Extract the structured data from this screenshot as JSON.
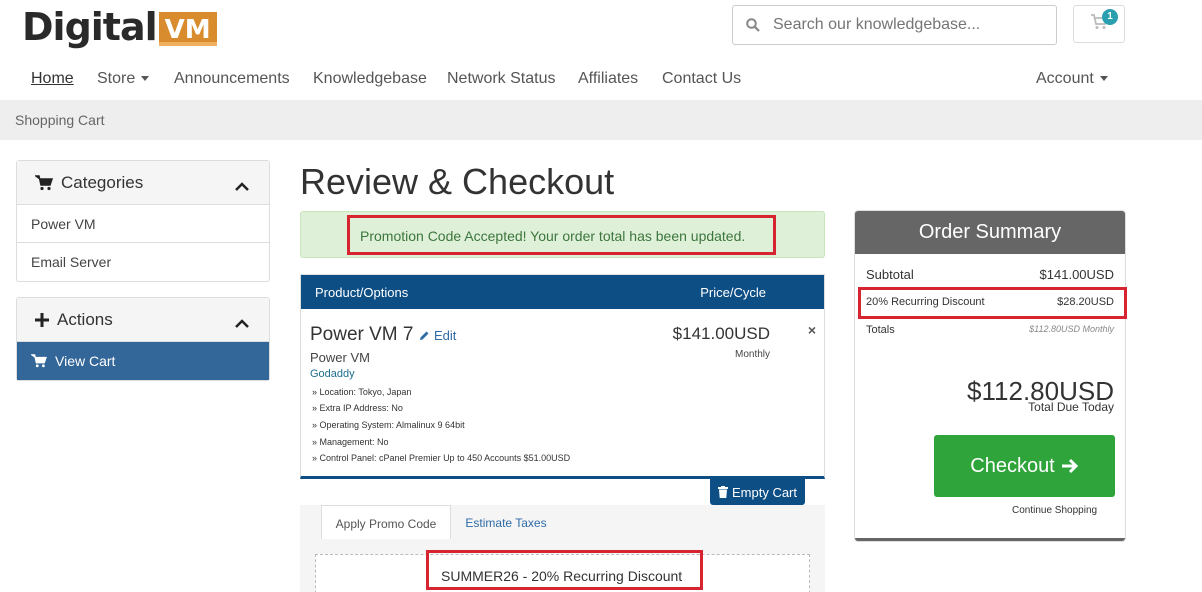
{
  "brand": {
    "name_part1": "Digital",
    "name_part2": "VM"
  },
  "search": {
    "placeholder": "Search our knowledgebase..."
  },
  "cart": {
    "count": "1"
  },
  "nav": {
    "home": "Home",
    "store": "Store",
    "announcements": "Announcements",
    "knowledgebase": "Knowledgebase",
    "network_status": "Network Status",
    "affiliates": "Affiliates",
    "contact_us": "Contact Us",
    "account": "Account"
  },
  "breadcrumb": "Shopping Cart",
  "sidebar": {
    "categories": {
      "title": "Categories",
      "items": [
        "Power VM",
        "Email Server"
      ]
    },
    "actions": {
      "title": "Actions",
      "items": [
        "View Cart"
      ]
    }
  },
  "page_title": "Review & Checkout",
  "alert": "Promotion Code Accepted! Your order total has been updated.",
  "table": {
    "col_product": "Product/Options",
    "col_price": "Price/Cycle",
    "product_name": "Power VM 7",
    "edit_label": "Edit",
    "product_group": "Power VM",
    "product_domain": "Godaddy",
    "options": [
      "» Location: Tokyo, Japan",
      "» Extra IP Address: No",
      "» Operating System: Almalinux 9 64bit",
      "» Management: No",
      "» Control Panel: cPanel Premier Up to 450 Accounts $51.00USD"
    ],
    "price": "$141.00USD",
    "cycle": "Monthly",
    "remove": "×"
  },
  "empty_cart": "Empty Cart",
  "tabs": {
    "promo": "Apply Promo Code",
    "taxes": "Estimate Taxes"
  },
  "promo_applied": "SUMMER26 - 20% Recurring Discount",
  "summary": {
    "title": "Order Summary",
    "subtotal_label": "Subtotal",
    "subtotal_value": "$141.00USD",
    "discount_label": "20% Recurring Discount",
    "discount_value": "$28.20USD",
    "totals_label": "Totals",
    "totals_value": "$112.80USD Monthly",
    "total_due": "$112.80USD",
    "total_due_label": "Total Due Today",
    "checkout": "Checkout",
    "continue": "Continue Shopping"
  },
  "colors": {
    "brand_orange": "#d98c2e",
    "nav_blue": "#0d4f85",
    "success_green": "#2ea43a",
    "highlight_red": "#d62531"
  }
}
